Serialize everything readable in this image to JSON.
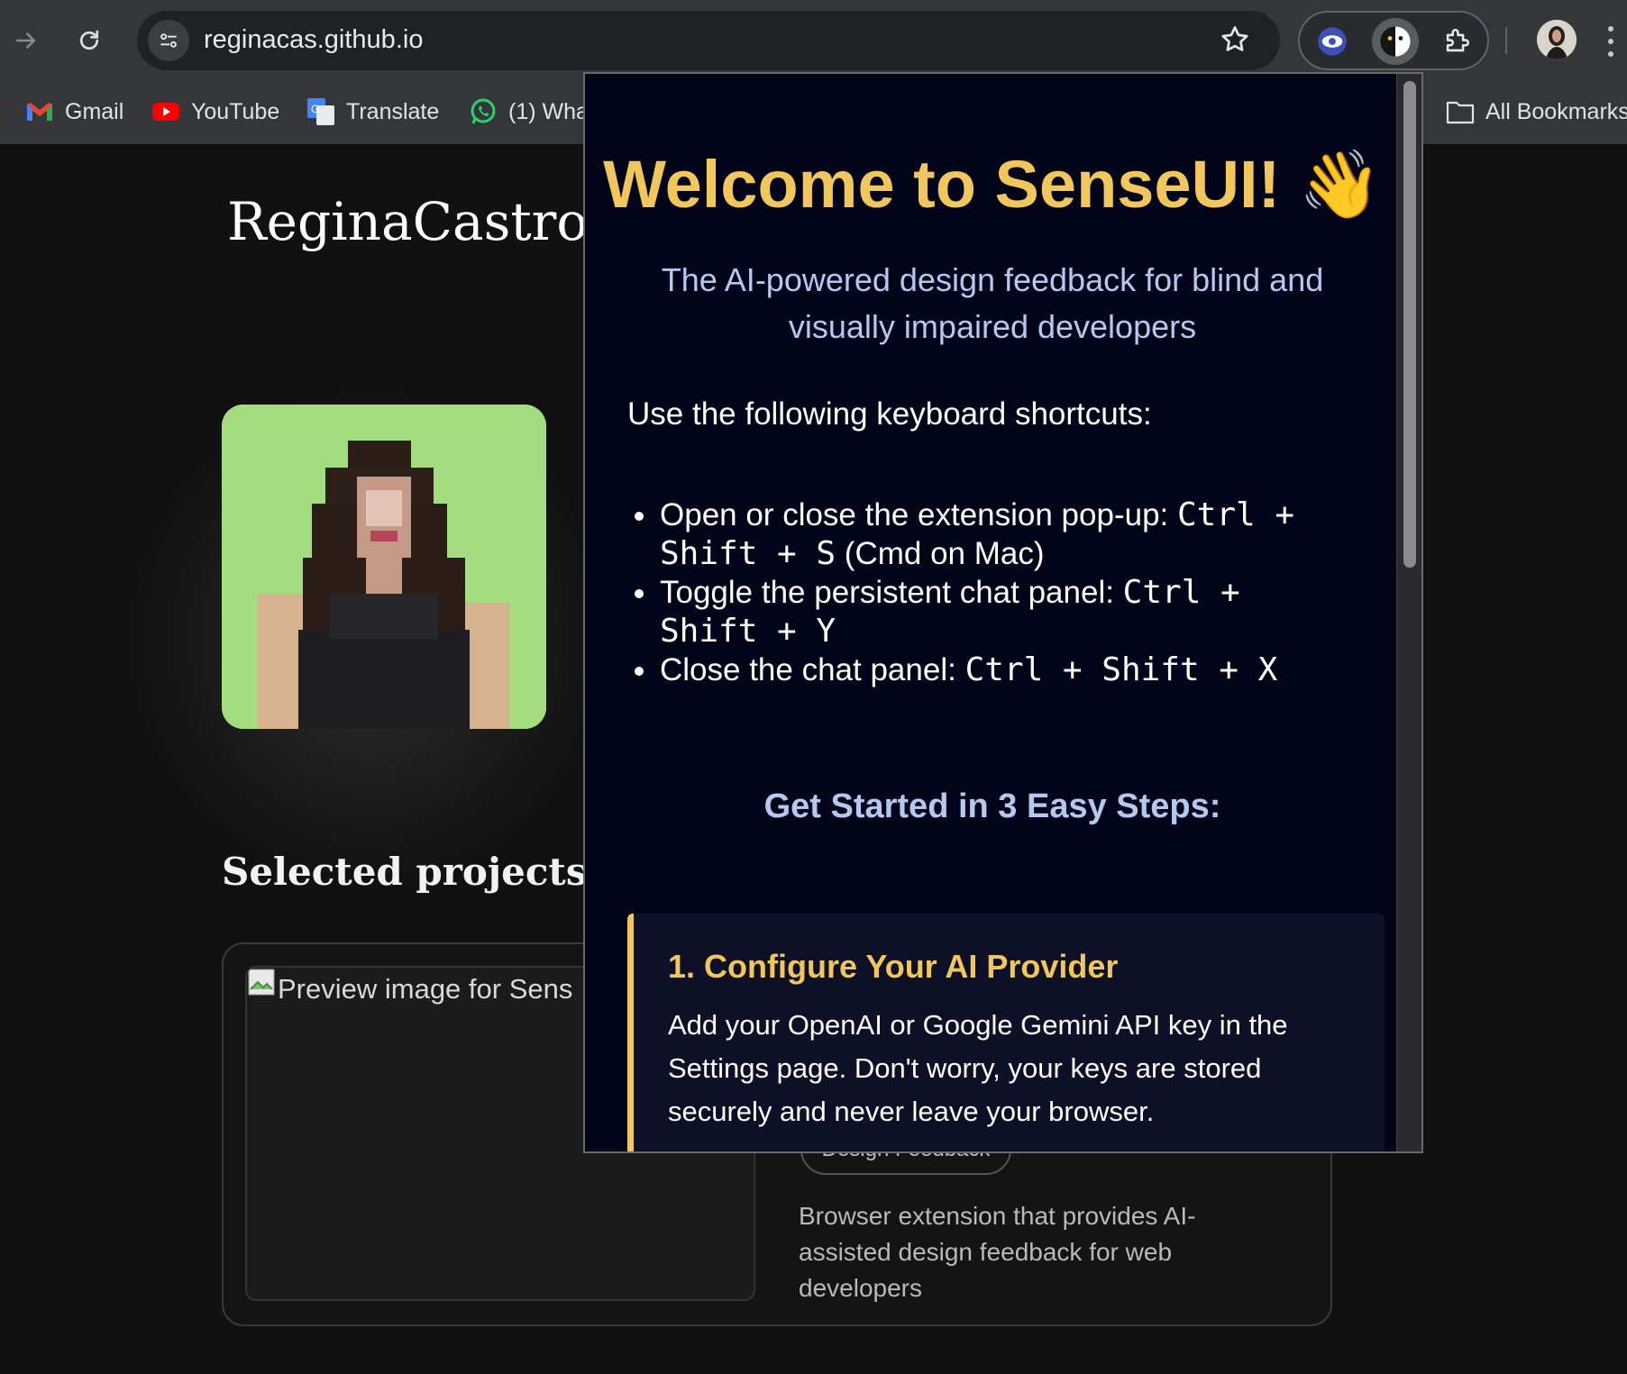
{
  "browser": {
    "url": "reginacas.github.io",
    "bookmarks": [
      {
        "label": "Gmail",
        "icon": "gmail-icon"
      },
      {
        "label": "YouTube",
        "icon": "youtube-icon"
      },
      {
        "label": "Translate",
        "icon": "translate-icon"
      },
      {
        "label": "(1) Wha",
        "icon": "whatsapp-icon"
      }
    ],
    "all_bookmarks_label": "All Bookmarks"
  },
  "page": {
    "logo": "ReginaCastro",
    "section_title": "Selected projects",
    "project": {
      "image_alt": "Preview image for Sens",
      "tag": "Design Feedback",
      "description": "Browser extension that provides AI-assisted design feedback for web developers"
    }
  },
  "popup": {
    "title": "Welcome to SenseUI! 👋",
    "subtitle": "The AI-powered design feedback for blind and visually impaired developers",
    "lead": "Use the following keyboard shortcuts:",
    "shortcuts": [
      {
        "text": "Open or close the extension pop-up: ",
        "keys": "Ctrl + Shift + S",
        "suffix": " (Cmd on Mac)"
      },
      {
        "text": "Toggle the persistent chat panel: ",
        "keys": "Ctrl + Shift + Y",
        "suffix": ""
      },
      {
        "text": "Close the chat panel: ",
        "keys": "Ctrl + Shift + X",
        "suffix": ""
      }
    ],
    "steps_title": "Get Started in 3 Easy Steps:",
    "step1": {
      "title": "1. Configure Your AI Provider",
      "body": "Add your OpenAI or Google Gemini API key in the Settings page. Don't worry, your keys are stored securely and never leave your browser."
    }
  },
  "colors": {
    "accent_gold": "#f1c75c",
    "accent_blue": "#b5c9ef",
    "popup_bg": "#02041a",
    "avatar_bg": "#a3dd80"
  }
}
